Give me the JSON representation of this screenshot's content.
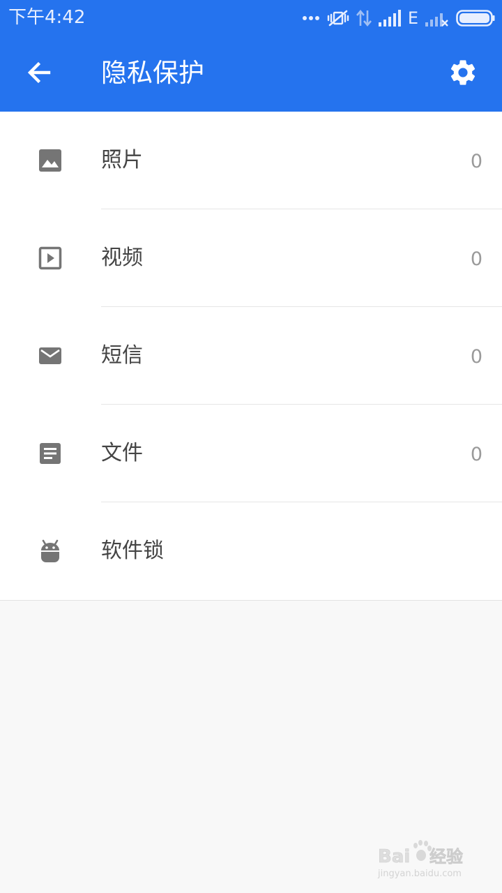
{
  "status_bar": {
    "time": "下午4:42",
    "network_type": "E",
    "icons": [
      "more-dots-icon",
      "vibrate-mute-icon",
      "data-transfer-icon",
      "signal-icon",
      "signal-no-sim-icon",
      "battery-icon"
    ]
  },
  "toolbar": {
    "title": "隐私保护",
    "back_icon": "arrow-back-icon",
    "settings_icon": "gear-icon"
  },
  "list": {
    "items": [
      {
        "label": "照片",
        "count": "0",
        "icon": "image-icon"
      },
      {
        "label": "视频",
        "count": "0",
        "icon": "video-play-icon"
      },
      {
        "label": "短信",
        "count": "0",
        "icon": "mail-icon"
      },
      {
        "label": "文件",
        "count": "0",
        "icon": "document-icon"
      },
      {
        "label": "软件锁",
        "count": "",
        "icon": "android-icon"
      }
    ]
  },
  "watermark": {
    "brand": "Baidu经验",
    "url": "jingyan.baidu.com"
  },
  "colors": {
    "header": "#2573ee",
    "icon_gray": "#757575",
    "label": "#444444",
    "count": "#9a9a9a",
    "background": "#f8f8f8"
  }
}
